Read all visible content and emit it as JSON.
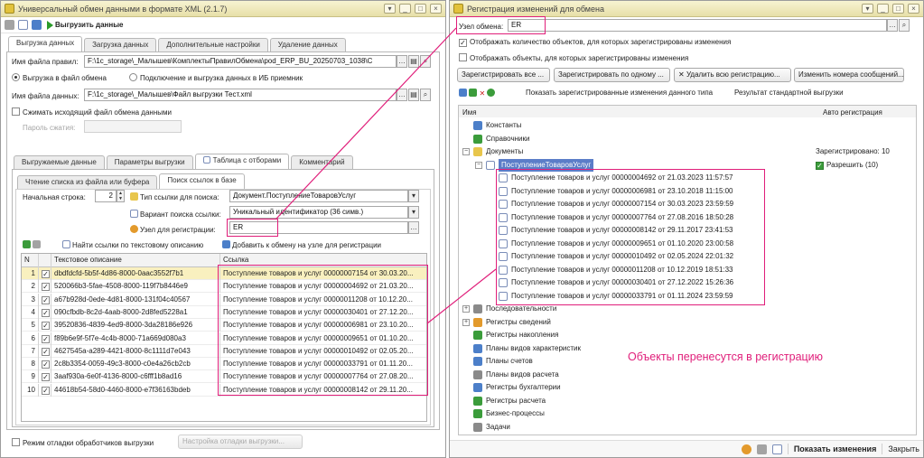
{
  "left": {
    "title": "Универсальный обмен данными в формате XML (2.1.7)",
    "toolbar": {
      "upload_label": "Выгрузить данные"
    },
    "tabs": [
      "Выгрузка данных",
      "Загрузка данных",
      "Дополнительные настройки",
      "Удаление данных"
    ],
    "rules_label": "Имя файла правил:",
    "rules_value": "F:\\1c_storage\\_Малышев\\КомплектыПравилОбмена\\pod_ERP_BU_20250703_1038\\С",
    "radio_file": "Выгрузка в файл обмена",
    "radio_ib": "Подключение и выгрузка данных в ИБ приемник",
    "data_file_label": "Имя файла данных:",
    "data_file_value": "F:\\1c_storage\\_Малышев\\Файл выгрузки Тест.xml",
    "compress_label": "Сжимать исходящий файл обмена данными",
    "password_label": "Пароль сжатия:",
    "subtabs": [
      "Выгружаемые данные",
      "Параметры выгрузки",
      "Таблица с отборами",
      "Комментарий"
    ],
    "innertabs": [
      "Чтение списка из файла или буфера",
      "Поиск ссылок в базе"
    ],
    "start_row_label": "Начальная строка:",
    "start_row_value": "2",
    "link_type_label": "Тип ссылки для поиска:",
    "link_type_value": "Документ.ПоступлениеТоваровУслуг",
    "search_variant_label": "Вариант поиска ссылки:",
    "search_variant_value": "Уникальный идентификатор (36 симв.)",
    "node_label": "Узел для регистрации:",
    "node_value": "ER",
    "find_links_label": "Найти ссылки по текстовому описанию",
    "add_node_label": "Добавить к обмену на узле для регистрации",
    "columns": [
      "N",
      "",
      "Текстовое описание",
      "Ссылка"
    ],
    "rows": [
      {
        "n": "1",
        "text": "dbdfdcfd-5b5f-4d86-8000-0aac3552f7b1",
        "ref": "Поступление товаров и услуг 00000007154 от 30.03.20..."
      },
      {
        "n": "2",
        "text": "520066b3-5fae-4508-8000-119f7b8446e9",
        "ref": "Поступление товаров и услуг 00000004692 от 21.03.20..."
      },
      {
        "n": "3",
        "text": "a67b928d-0ede-4d81-8000-131f04c40567",
        "ref": "Поступление товаров и услуг 00000011208 от 10.12.20..."
      },
      {
        "n": "4",
        "text": "090cfbdb-8c2d-4aab-8000-2d8fed5228a1",
        "ref": "Поступление товаров и услуг 00000030401 от 27.12.20..."
      },
      {
        "n": "5",
        "text": "39520836-4839-4ed9-8000-3da28186e926",
        "ref": "Поступление товаров и услуг 00000006981 от 23.10.20..."
      },
      {
        "n": "6",
        "text": "f89b6e9f-5f7e-4c4b-8000-71a669d080a3",
        "ref": "Поступление товаров и услуг 00000009651 от 01.10.20..."
      },
      {
        "n": "7",
        "text": "4627545a-a289-4421-8000-8c1111d7e043",
        "ref": "Поступление товаров и услуг 00000010492 от 02.05.20..."
      },
      {
        "n": "8",
        "text": "2c8b3354-0059-49c3-8000-c0e4a26cb2cb",
        "ref": "Поступление товаров и услуг 00000033791 от 01.11.20..."
      },
      {
        "n": "9",
        "text": "3aaf930a-6e0f-4136-8000-c6fff1b8ad16",
        "ref": "Поступление товаров и услуг 00000007764 от 27.08.20..."
      },
      {
        "n": "10",
        "text": "44618b54-58d0-4460-8000-e7f36163bdeb",
        "ref": "Поступление товаров и услуг 00000008142 от 29.11.20..."
      }
    ],
    "debug_label": "Режим отладки обработчиков выгрузки",
    "debug_settings_label": "Настройка отладки выгрузки..."
  },
  "right": {
    "title": "Регистрация изменений для обмена",
    "node_label": "Узел обмена:",
    "node_value": "ER",
    "show_count_label": "Отображать количество объектов, для которых зарегистрированы изменения",
    "show_objects_label": "Отображать объекты, для которых зарегистрированы изменения",
    "btn_register_all": "Зарегистрировать все ...",
    "btn_register_one": "Зарегистрировать по одному ...",
    "btn_delete_all": "Удалить всю регистрацию...",
    "btn_change_numbers": "Изменить номера сообщений...",
    "show_changes_type": "Показать зарегистрированные изменения данного типа",
    "standard_unload": "Результат стандартной выгрузки",
    "col_name": "Имя",
    "col_auto": "Авто регистрация",
    "registered_count": "Зарегистрировано: 10",
    "allowed_label": "Разрешить (10)",
    "tree_top": [
      "Константы",
      "Справочники",
      "Документы"
    ],
    "tree_doc": "ПоступлениеТоваровУслуг",
    "docs": [
      "Поступление товаров и услуг 00000004692 от 21.03.2023 11:57:57",
      "Поступление товаров и услуг 00000006981 от 23.10.2018 11:15:00",
      "Поступление товаров и услуг 00000007154 от 30.03.2023 23:59:59",
      "Поступление товаров и услуг 00000007764 от 27.08.2016 18:50:28",
      "Поступление товаров и услуг 00000008142 от 29.11.2017 23:41:53",
      "Поступление товаров и услуг 00000009651 от 01.10.2020 23:00:58",
      "Поступление товаров и услуг 00000010492 от 02.05.2024 22:01:32",
      "Поступление товаров и услуг 00000011208 от 10.12.2019 18:51:33",
      "Поступление товаров и услуг 00000030401 от 27.12.2022 15:26:36",
      "Поступление товаров и услуг 00000033791 от 01.11.2024 23:59:59"
    ],
    "tree_bottom": [
      "Последовательности",
      "Регистры сведений",
      "Регистры накопления",
      "Планы видов характеристик",
      "Планы счетов",
      "Планы видов расчета",
      "Регистры бухгалтерии",
      "Регистры расчета",
      "Бизнес-процессы",
      "Задачи"
    ],
    "btn_show_changes": "Показать изменения",
    "btn_close": "Закрыть"
  },
  "annotation": "Объекты перенесутся в регистрацию",
  "colors": {
    "accent": "#e01e7a",
    "selection": "#5b7dc8",
    "title_bar": "#efe8bc"
  }
}
